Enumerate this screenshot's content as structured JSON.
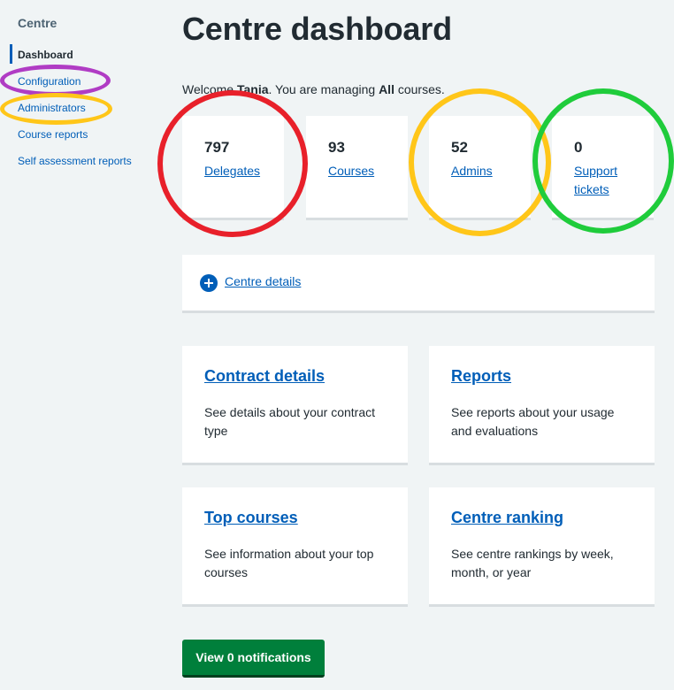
{
  "sidebar": {
    "heading": "Centre",
    "items": [
      {
        "label": "Dashboard",
        "current": true
      },
      {
        "label": "Configuration"
      },
      {
        "label": "Administrators"
      },
      {
        "label": "Course reports"
      },
      {
        "label": "Self assessment reports"
      }
    ]
  },
  "main": {
    "title": "Centre dashboard",
    "welcome": {
      "prefix": "Welcome ",
      "user": "Tania",
      "middle": ". You are managing ",
      "scope": "All",
      "suffix": " courses."
    },
    "stats": [
      {
        "value": "797",
        "label": "Delegates"
      },
      {
        "value": "93",
        "label": "Courses"
      },
      {
        "value": "52",
        "label": "Admins"
      },
      {
        "value": "0",
        "label": "Support tickets"
      }
    ],
    "details_label": "Centre details",
    "features": [
      {
        "title": "Contract details",
        "desc": "See details about your contract type"
      },
      {
        "title": "Reports",
        "desc": "See reports about your usage and evaluations"
      },
      {
        "title": "Top courses",
        "desc": "See information about your top courses"
      },
      {
        "title": "Centre ranking",
        "desc": "See centre rankings by week, month, or year"
      }
    ],
    "notifications_button": "View 0 notifications"
  },
  "colors": {
    "background": "#f0f4f5",
    "link": "#005eb8",
    "button_green": "#007f3b",
    "ring_red": "#e8202a",
    "ring_yellow": "#ffc619",
    "ring_green": "#1fcc3b",
    "ring_purple": "#b03cc4"
  }
}
